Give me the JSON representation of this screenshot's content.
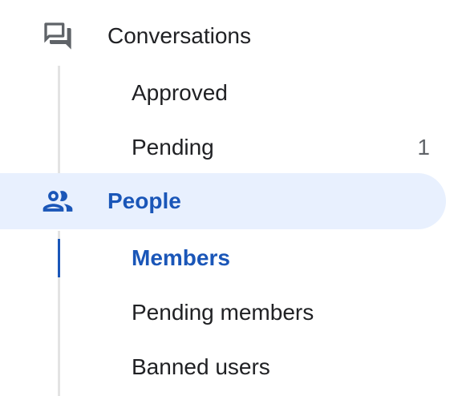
{
  "nav": {
    "conversations": {
      "label": "Conversations",
      "icon": "forum-icon",
      "items": [
        {
          "label": "Approved",
          "count": ""
        },
        {
          "label": "Pending",
          "count": "1"
        }
      ]
    },
    "people": {
      "label": "People",
      "icon": "people-icon",
      "active": true,
      "items": [
        {
          "label": "Members",
          "active": true
        },
        {
          "label": "Pending members"
        },
        {
          "label": "Banned users"
        }
      ]
    }
  },
  "colors": {
    "accent": "#1a56b8",
    "active_background": "#e8f0fe",
    "text": "#202124",
    "muted": "#5f6368",
    "rail": "#e3e3e3",
    "icon_gray": "#5f6368"
  }
}
